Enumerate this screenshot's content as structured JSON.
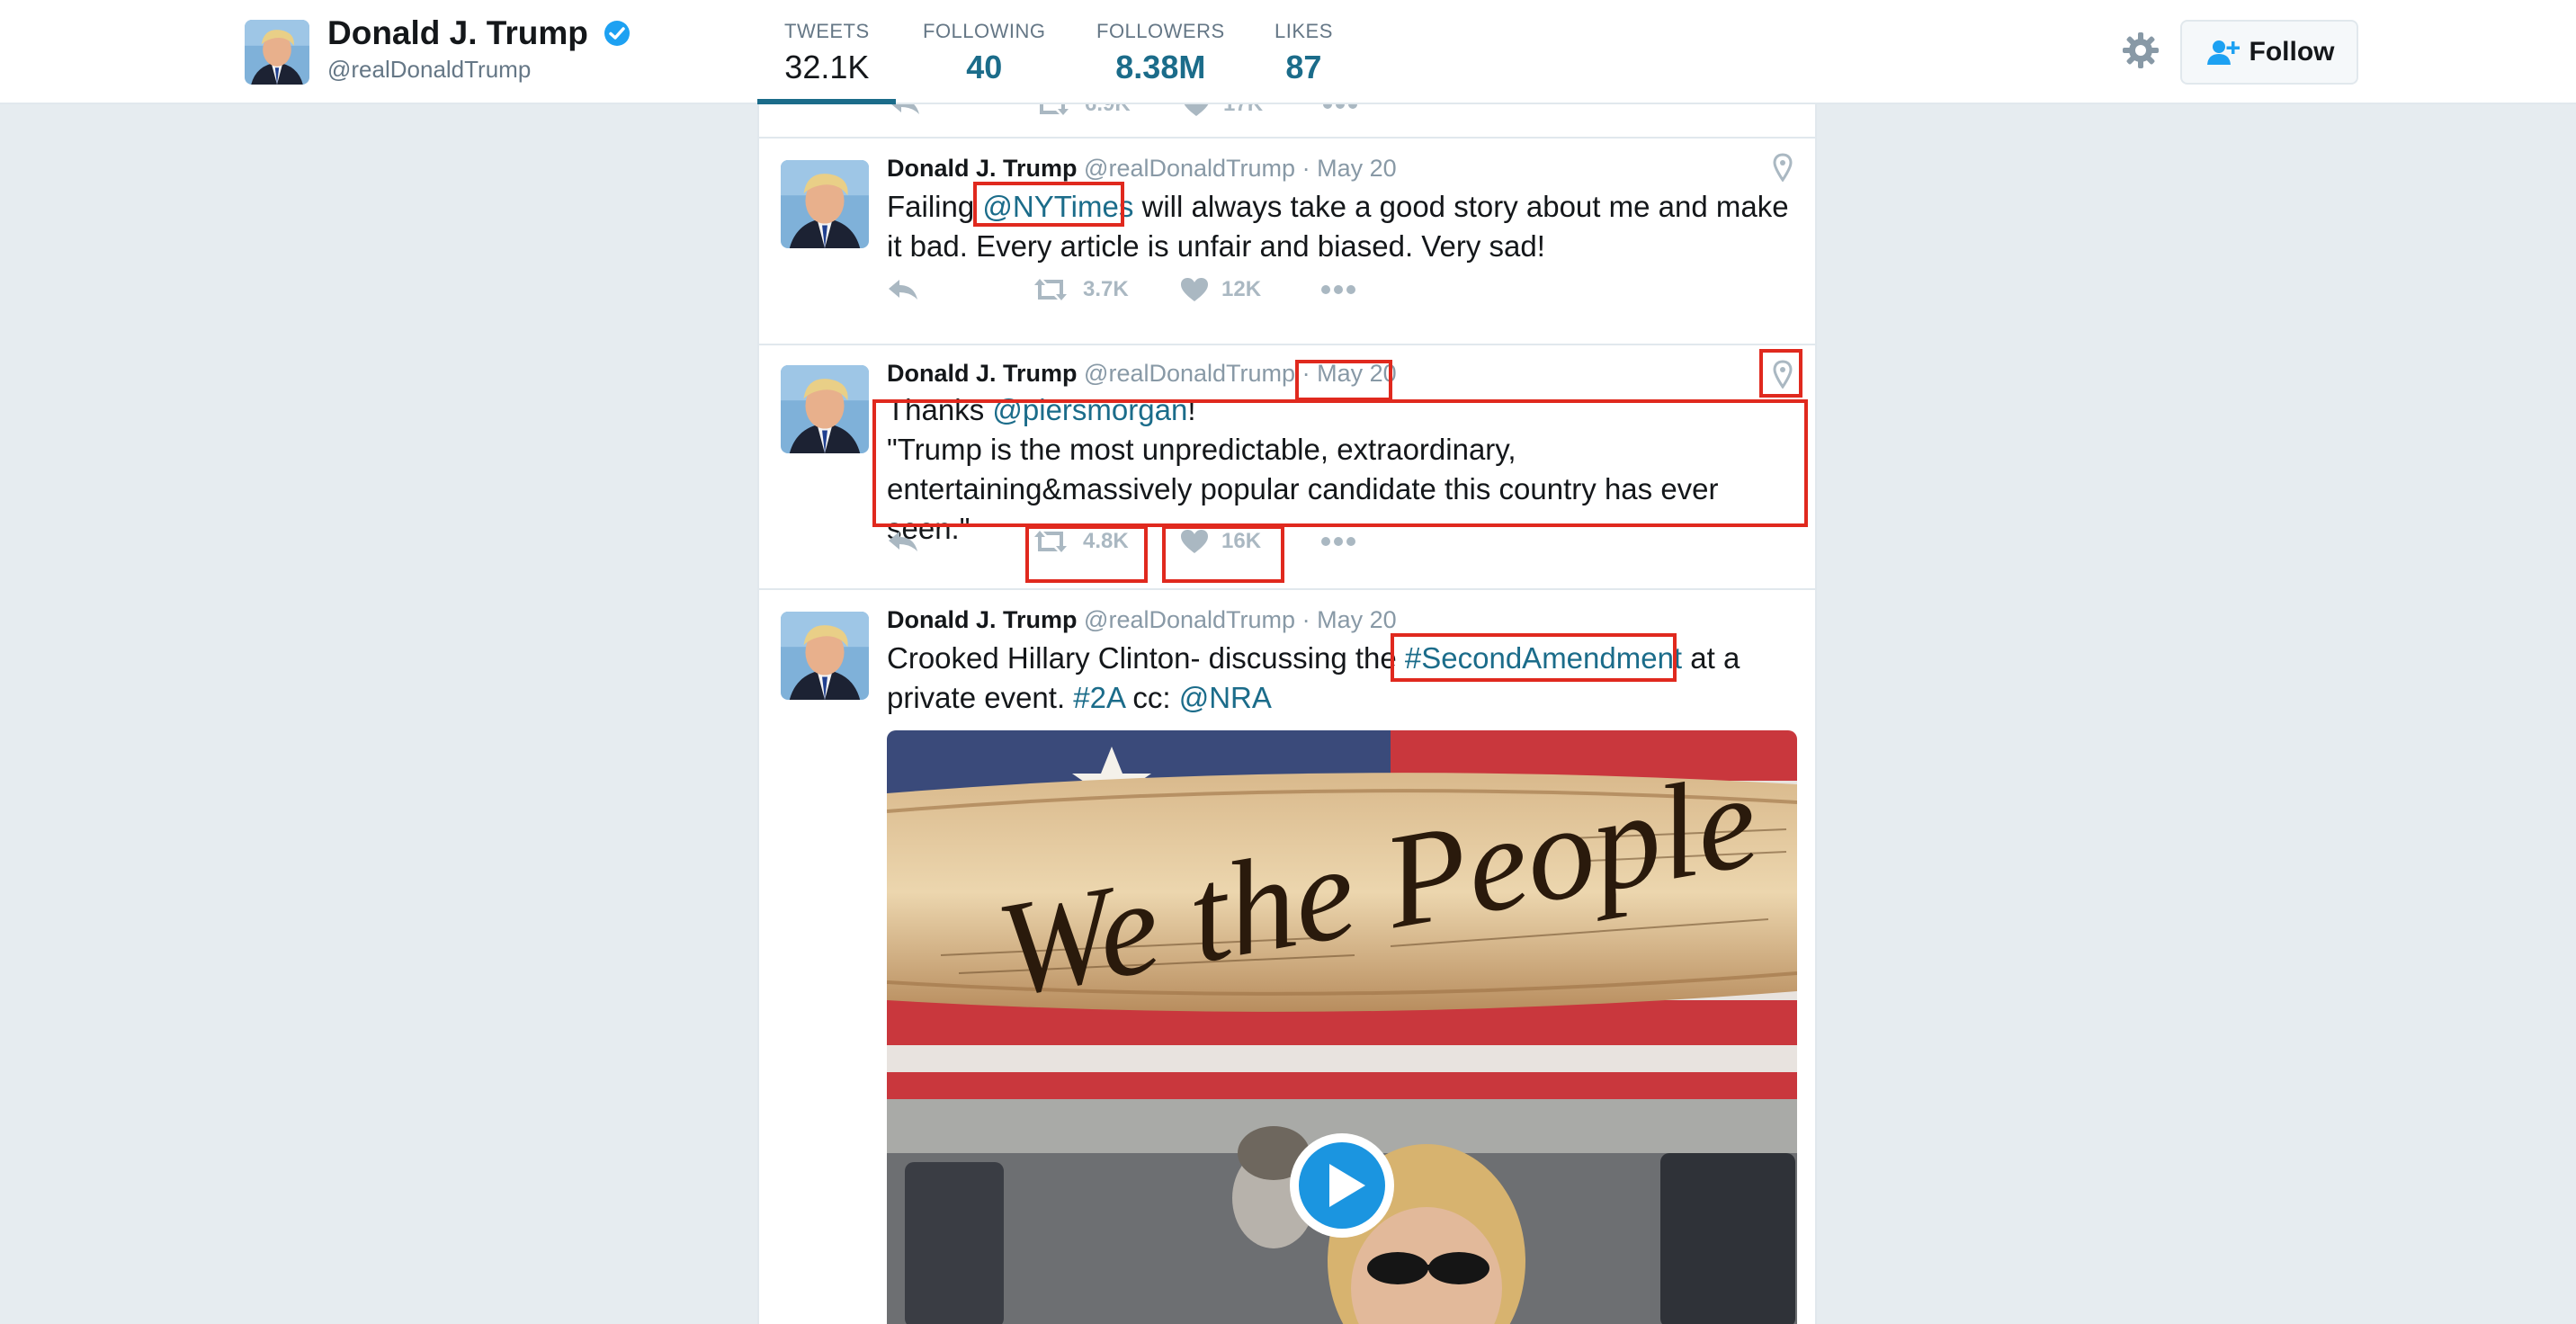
{
  "header": {
    "name": "Donald J. Trump",
    "handle": "@realDonaldTrump",
    "nav": [
      {
        "label": "TWEETS",
        "value": "32.1K"
      },
      {
        "label": "FOLLOWING",
        "value": "40"
      },
      {
        "label": "FOLLOWERS",
        "value": "8.38M"
      },
      {
        "label": "LIKES",
        "value": "87"
      }
    ],
    "follow_label": "Follow"
  },
  "previous_tweet": {
    "retweets": "6.9K",
    "likes": "17K"
  },
  "tweets": [
    {
      "name": "Donald J. Trump",
      "handle": "@realDonaldTrump",
      "time": "May 20",
      "text_pre": "Failing ",
      "mention": "@NYTimes",
      "text_post": " will always take a good story about me and make it bad. Every article is unfair and biased. Very sad!",
      "retweets": "3.7K",
      "likes": "12K"
    },
    {
      "name": "Donald J. Trump",
      "handle": "@realDonaldTrump",
      "time": "May 20",
      "text_pre": "Thanks ",
      "mention": "@piersmorgan",
      "text_post": "!",
      "line2": "\"Trump is the most unpredictable, extraordinary, entertaining&massively popular candidate this country has ever seen.\"",
      "retweets": "4.8K",
      "likes": "16K"
    },
    {
      "name": "Donald J. Trump",
      "handle": "@realDonaldTrump",
      "time": "May 20",
      "text_pre": "Crooked Hillary Clinton- discussing the ",
      "hashtag": "#SecondAmendment",
      "text_mid": " at a private event. ",
      "hashtag2": "#2A",
      "text_cc": " cc: ",
      "mention": "@NRA",
      "media_text": "We the People"
    }
  ],
  "colors": {
    "accent": "#1b6c8a",
    "highlight": "#e0291e",
    "muted": "#8899a6",
    "icon": "#aab8c2",
    "verified": "#1da1f2"
  }
}
